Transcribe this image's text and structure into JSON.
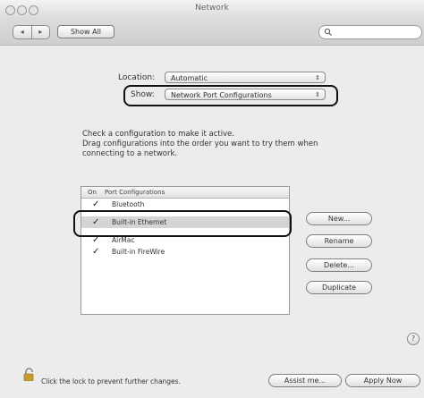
{
  "window": {
    "title": "Network"
  },
  "toolbar": {
    "back": "◂",
    "forward": "▸",
    "show_all": "Show All",
    "search_icon": "search-icon"
  },
  "location": {
    "label": "Location:",
    "value": "Automatic"
  },
  "show": {
    "label": "Show:",
    "value": "Network Port Configurations"
  },
  "instructions": {
    "line1": "Check a configuration to make it active.",
    "line2": "Drag configurations into the order you want to try them when",
    "line3": "connecting to a network."
  },
  "ports": {
    "header_on": "On",
    "header_name": "Port Configurations",
    "items": [
      {
        "name": "Bluetooth",
        "checked": true
      },
      {
        "name": "Built-in Ethernet",
        "checked": true,
        "selected": true
      },
      {
        "name": "AirMac",
        "checked": true
      },
      {
        "name": "Built-in FireWire",
        "checked": true
      }
    ]
  },
  "actions": {
    "new": "New...",
    "rename": "Rename",
    "delete": "Delete...",
    "duplicate": "Duplicate"
  },
  "footer": {
    "lock_text": "Click the lock to prevent further changes.",
    "assist": "Assist me...",
    "apply": "Apply Now",
    "help": "?"
  },
  "accent": {
    "highlight_outline": "#111111",
    "selected_row": "#d4d4d4",
    "lock_gold": "#c69a2e"
  }
}
